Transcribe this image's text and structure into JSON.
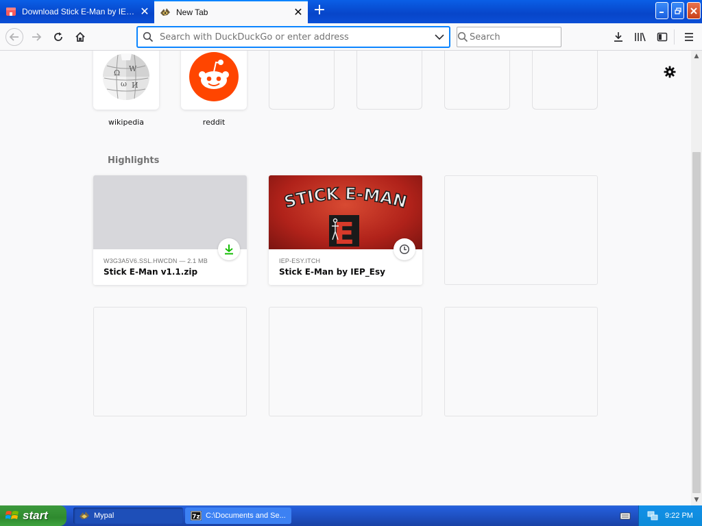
{
  "tabs": [
    {
      "title": "Download Stick E-Man by IEP_Esy",
      "active": false
    },
    {
      "title": "New Tab",
      "active": true
    }
  ],
  "toolbar": {
    "url_placeholder": "Search with DuckDuckGo or enter address",
    "search_placeholder": "Search"
  },
  "top_sites": [
    {
      "label": "wikipedia"
    },
    {
      "label": "reddit"
    }
  ],
  "highlights": {
    "title": "Highlights",
    "cards": [
      {
        "host": "W3G3A5V6.SSL.HWCDN — 2.1 MB",
        "title": "Stick E-Man v1.1.zip",
        "badge": "download-icon"
      },
      {
        "host": "IEP-ESY.ITCH",
        "title": "Stick E-Man by IEP_Esy",
        "badge": "clock-icon",
        "preview_text": "STICK E-MAN",
        "preview_letter": "E"
      }
    ]
  },
  "taskbar": {
    "start_label": "start",
    "tasks": [
      {
        "label": "Mypal"
      },
      {
        "label": "C:\\Documents and Se..."
      }
    ],
    "clock": "9:22 PM"
  },
  "colors": {
    "accent": "#0a84ff",
    "download_green": "#12bc00",
    "reddit_orange": "#ff4500",
    "itch_red": "#c0281c"
  }
}
